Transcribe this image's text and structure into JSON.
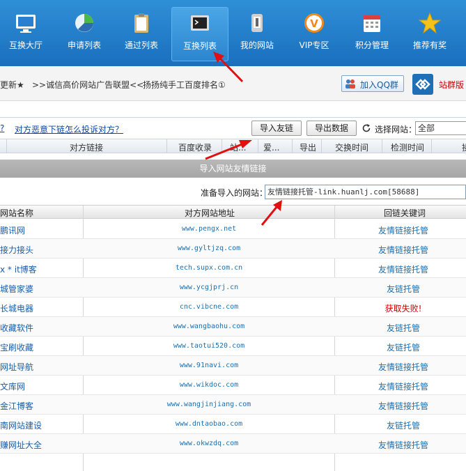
{
  "nav": [
    {
      "label": "互换大厅",
      "icon": "monitor-icon"
    },
    {
      "label": "申请列表",
      "icon": "pie-chart-icon"
    },
    {
      "label": "通过列表",
      "icon": "clipboard-icon"
    },
    {
      "label": "互换列表",
      "icon": "terminal-icon"
    },
    {
      "label": "我的网站",
      "icon": "phone-icon"
    },
    {
      "label": "VIP专区",
      "icon": "vip-badge-icon"
    },
    {
      "label": "积分管理",
      "icon": "calendar-icon"
    },
    {
      "label": "推荐有奖",
      "icon": "star-icon"
    }
  ],
  "notice": {
    "text1": "更新★",
    "text2": ">>诚信高价网站广告联盟<<",
    "text3": "扬扬纯手工百度排名①",
    "qq_button": "加入QQ群",
    "site_group": "站群版"
  },
  "toolbar": {
    "link1": "?",
    "link2": "对方恶意下链怎么投诉对方？",
    "import_button": "导入友链",
    "export_button": "导出数据",
    "select_label": "选择网站：",
    "select_value": "全部"
  },
  "table_header": [
    "对方链接",
    "百度收录",
    "站...",
    "爱...",
    "导出",
    "交换时间",
    "检测时间",
    "操"
  ],
  "modal": {
    "title": "导入网站友情链接",
    "prepare_label": "准备导入的网站：",
    "prepare_value": "友情链接托管-link.huanlj.com[58688]",
    "columns": [
      "网站名称",
      "对方网站地址",
      "回链关键词"
    ],
    "rows": [
      {
        "name": "鹏讯网",
        "url": "www.pengx.net",
        "keyword": "友情链接托管",
        "status": "ok"
      },
      {
        "name": "接力接头",
        "url": "www.gyltjzq.com",
        "keyword": "友情链接托管",
        "status": "ok"
      },
      {
        "name": "x * it博客",
        "url": "tech.supx.com.cn",
        "keyword": "友情链接托管",
        "status": "ok"
      },
      {
        "name": "城管家婆",
        "url": "www.ycgjprj.cn",
        "keyword": "友链托管",
        "status": "ok"
      },
      {
        "name": "长城电器",
        "url": "cnc.vibcne.com",
        "keyword": "获取失败!",
        "status": "error"
      },
      {
        "name": "收藏软件",
        "url": "www.wangbaohu.com",
        "keyword": "友链托管",
        "status": "ok"
      },
      {
        "name": "宝刷收藏",
        "url": "www.taotui520.com",
        "keyword": "友链托管",
        "status": "ok"
      },
      {
        "name": "网址导航",
        "url": "www.91navi.com",
        "keyword": "友情链接托管",
        "status": "ok"
      },
      {
        "name": "文库网",
        "url": "www.wikdoc.com",
        "keyword": "友情链接托管",
        "status": "ok"
      },
      {
        "name": "金江博客",
        "url": "www.wangjinjiang.com",
        "keyword": "友情链接托管",
        "status": "ok"
      },
      {
        "name": "南网站建设",
        "url": "www.dntaobao.com",
        "keyword": "友链托管",
        "status": "ok"
      },
      {
        "name": "赚网址大全",
        "url": "www.okwzdq.com",
        "keyword": "友情链接托管",
        "status": "ok"
      }
    ]
  },
  "colors": {
    "nav_bg": "#1a6fbe",
    "link_blue": "#1a6fb0",
    "notice_red": "#c40000",
    "error_red": "#d40000",
    "arrow_red": "#e01010"
  }
}
